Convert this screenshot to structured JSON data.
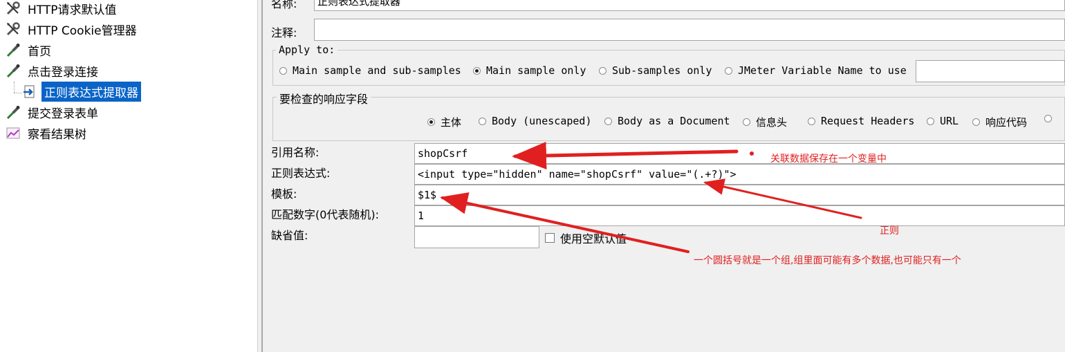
{
  "tree": {
    "items": [
      {
        "label": "HTTP请求默认值",
        "icon": "wrench-icon"
      },
      {
        "label": "HTTP Cookie管理器",
        "icon": "wrench-icon"
      },
      {
        "label": "首页",
        "icon": "pipette-icon"
      },
      {
        "label": "点击登录连接",
        "icon": "pipette-icon"
      },
      {
        "label": "正则表达式提取器",
        "icon": "extractor-icon",
        "selected": true
      },
      {
        "label": "提交登录表单",
        "icon": "pipette-icon"
      },
      {
        "label": "察看结果树",
        "icon": "chart-icon"
      }
    ]
  },
  "form": {
    "name_label": "名称:",
    "name_value": "正则表达式提取器",
    "comment_label": "注释:",
    "comment_value": "",
    "apply_to": {
      "legend": "Apply to:",
      "options": [
        {
          "label": "Main sample and sub-samples",
          "checked": false
        },
        {
          "label": "Main sample only",
          "checked": true
        },
        {
          "label": "Sub-samples only",
          "checked": false
        },
        {
          "label": "JMeter Variable Name to use",
          "checked": false
        }
      ],
      "variable_value": ""
    },
    "field_to_check": {
      "legend": "要检查的响应字段",
      "options": [
        {
          "label": "主体",
          "checked": true
        },
        {
          "label": "Body (unescaped)",
          "checked": false
        },
        {
          "label": "Body as a Document",
          "checked": false
        },
        {
          "label": "信息头",
          "checked": false
        },
        {
          "label": "Request Headers",
          "checked": false
        },
        {
          "label": "URL",
          "checked": false
        },
        {
          "label": "响应代码",
          "checked": false
        }
      ]
    },
    "ref_name_label": "引用名称:",
    "ref_name_value": "shopCsrf",
    "regex_label": "正则表达式:",
    "regex_value": "<input type=\"hidden\" name=\"shopCsrf\" value=\"(.+?)\">",
    "template_label": "模板:",
    "template_value": "$1$",
    "match_no_label": "匹配数字(0代表随机):",
    "match_no_value": "1",
    "default_label": "缺省值:",
    "default_value": "",
    "use_empty_default_label": "使用空默认值"
  },
  "annotations": {
    "variable_note": "关联数据保存在一个变量中",
    "regex_note": "正则",
    "group_note": "一个圆括号就是一个组,组里面可能有多个数据,也可能只有一个",
    "color": "#e02020"
  }
}
